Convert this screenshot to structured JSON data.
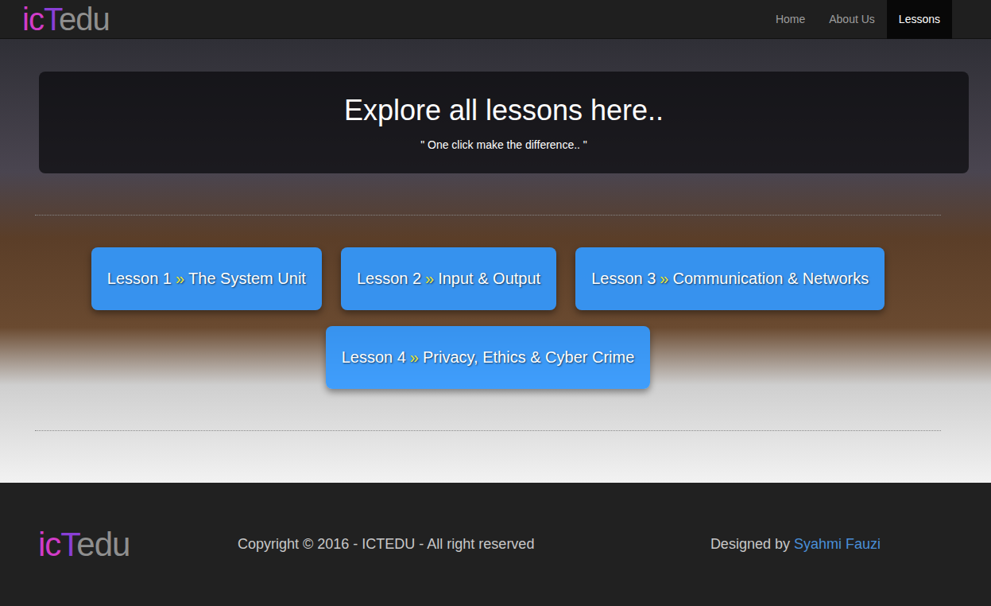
{
  "logo": {
    "parts": [
      {
        "text": "ic",
        "color": "#d23cc8"
      },
      {
        "text": "T",
        "color": "#8a3fd6"
      },
      {
        "text": "edu",
        "color": "#8f8f8f"
      }
    ]
  },
  "nav": [
    {
      "label": "Home",
      "selected": false
    },
    {
      "label": "About Us",
      "selected": false
    },
    {
      "label": "Lessons",
      "selected": true
    }
  ],
  "hero": {
    "title": "Explore all lessons here..",
    "subtitle": "\" One click make the difference.. \""
  },
  "lessons": [
    {
      "number": "Lesson 1",
      "separator": "»",
      "title": "The System Unit"
    },
    {
      "number": "Lesson 2",
      "separator": "»",
      "title": "Input & Output"
    },
    {
      "number": "Lesson 3",
      "separator": "»",
      "title": "Communication & Networks"
    },
    {
      "number": "Lesson 4",
      "separator": "»",
      "title": "Privacy, Ethics & Cyber Crime"
    }
  ],
  "footer": {
    "copyright": "Copyright © 2016 - ICTEDU - All right reserved",
    "designed_by": "Designed by",
    "author": "Syahmi Fauzi"
  }
}
